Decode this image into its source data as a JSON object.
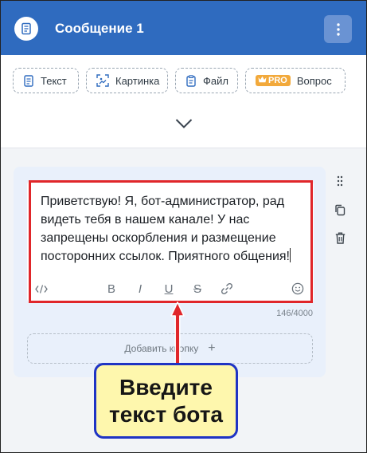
{
  "header": {
    "icon": "document-icon",
    "title": "Сообщение 1",
    "menu_icon": "more-vertical-icon"
  },
  "chips": [
    {
      "icon": "document-icon",
      "label": "Текст"
    },
    {
      "icon": "image-scan-icon",
      "label": "Картинка"
    },
    {
      "icon": "file-icon",
      "label": "Файл"
    },
    {
      "icon": "crown-icon",
      "badge": "PRO",
      "label": "Вопрос"
    }
  ],
  "expand_icon": "chevron-down-icon",
  "editor": {
    "text": "Приветствую! Я, бот-администратор, рад видеть тебя в нашем канале! У нас запрещены оскорбления и размещение посторонних ссылок. Приятного общения!",
    "toolbar": {
      "code": "</>",
      "bold": "B",
      "italic": "I",
      "underline": "U",
      "strike": "S"
    },
    "char_count": "146/4000"
  },
  "add_button": {
    "label": "Добавить кнопку",
    "plus": "+"
  },
  "side_actions": [
    "drag-handle-icon",
    "copy-icon",
    "trash-icon"
  ],
  "annotation": {
    "line1": "Введите",
    "line2": "текст бота",
    "arrow_color": "#e0262a",
    "box_border_color": "#1f34c4",
    "box_fill_color": "#fef7ad"
  },
  "colors": {
    "header_bg": "#2f6bbf",
    "highlight": "#e0262a",
    "pro_badge": "#f2a93b"
  }
}
